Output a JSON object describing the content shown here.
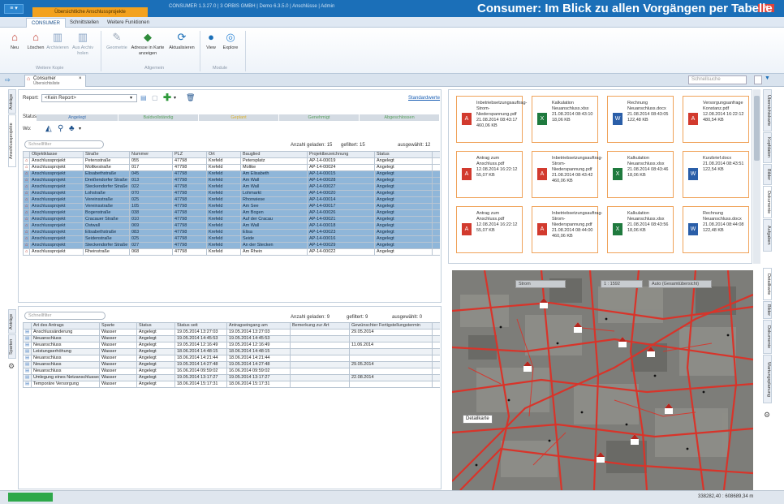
{
  "app": {
    "menu_label": "≡ ▾",
    "context_tab": "Übersichtliche Anschlussprojekte",
    "window_title": "CONSUMER 1.3.27.0 | 3 ORBIS GMBH | Demo 6.3.5.0 | Anschlüsse | Admin",
    "banner": "Consumer: Im Blick zu allen Vorgängen per Tabelle und Karte"
  },
  "ribbon": {
    "tabs": [
      "CONSUMER",
      "Schnittstellen",
      "Weitere Funktionen"
    ],
    "buttons": [
      {
        "label": "Neu",
        "icon": "new-record-icon"
      },
      {
        "label": "Löschen",
        "icon": "delete-record-icon"
      },
      {
        "label": "Archivieren",
        "icon": "archive-icon"
      },
      {
        "label": "Aus Archiv holen",
        "icon": "unarchive-icon"
      },
      {
        "label": "Geometrie",
        "icon": "geometry-icon"
      },
      {
        "label": "Adresse in Karte anzeigen",
        "icon": "map-address-icon"
      },
      {
        "label": "Aktualisieren",
        "icon": "refresh-icon"
      },
      {
        "label": "View",
        "icon": "globe-view-icon"
      },
      {
        "label": "Explore",
        "icon": "globe-explore-icon"
      }
    ],
    "groups": [
      "Weitere Kopie",
      "Allgemein",
      "Module"
    ]
  },
  "doc_tab": {
    "title": "Consumer",
    "subtitle": "Übersichtsliste",
    "close": "×"
  },
  "quick_search_placeholder": "Schnellsuche",
  "left_vtabs": [
    "Anträge",
    "Anschlussprojekte"
  ],
  "left_bottom_vtabs": [
    "Anträge",
    "Sparten"
  ],
  "right_top_vtabs": [
    "Übersichtskarte",
    "Kopfdaten",
    "Bilder",
    "Dokumente",
    "Aufgaben"
  ],
  "right_bottom_vtabs": [
    "Detailkarte",
    "Bilder",
    "Dokumente",
    "Wartungsplanung"
  ],
  "report": {
    "label": "Report:",
    "value": "<Kein Report>",
    "standard_link": "Standardwerte",
    "status_label": "Status:",
    "statuses": [
      "Angelegt",
      "Baldvollständig",
      "Geplant",
      "Genehmigt",
      "Abgeschlossen"
    ],
    "wo_label": "Wo:"
  },
  "upper_grid": {
    "filter_placeholder": "Schnellfilter",
    "loaded": "Anzahl geladen: 15",
    "filtered": "gefiltert: 15",
    "selected": "ausgewählt: 12",
    "columns": [
      "Objektklasse",
      "Straße",
      "Nummer",
      "PLZ",
      "Ort",
      "Bauglied",
      "Projektbezeichnung",
      "Status"
    ],
    "rows": [
      {
        "sel": false,
        "cells": [
          "Anschlussprojekt",
          "Petersstraße",
          "055",
          "47798",
          "Krefeld",
          "Petersplatz",
          "AP-14-00019",
          "Angelegt"
        ]
      },
      {
        "sel": false,
        "cells": [
          "Anschlussprojekt",
          "Moltkestraße",
          "017",
          "47798",
          "Krefeld",
          "Moltke",
          "AP-14-00024",
          "Angelegt"
        ]
      },
      {
        "sel": true,
        "cells": [
          "Anschlussprojekt",
          "Elisabethstraße",
          "045",
          "47798",
          "Krefeld",
          "Am Elisabeth",
          "AP-14-00015",
          "Angelegt"
        ]
      },
      {
        "sel": true,
        "cells": [
          "Anschlussprojekt",
          "Dreißendorfer Straße",
          "013",
          "47798",
          "Krefeld",
          "Am Wall",
          "AP-14-00028",
          "Angelegt"
        ]
      },
      {
        "sel": true,
        "cells": [
          "Anschlussprojekt",
          "Steckendorfer Straße",
          "022",
          "47798",
          "Krefeld",
          "Am Wall",
          "AP-14-00027",
          "Angelegt"
        ]
      },
      {
        "sel": true,
        "cells": [
          "Anschlussprojekt",
          "Lohstraße",
          "070",
          "47798",
          "Krefeld",
          "Lohmarkt",
          "AP-14-00020",
          "Angelegt"
        ]
      },
      {
        "sel": true,
        "cells": [
          "Anschlussprojekt",
          "Vereinsstraße",
          "025",
          "47798",
          "Krefeld",
          "Rhonwiese",
          "AP-14-00014",
          "Angelegt"
        ]
      },
      {
        "sel": true,
        "cells": [
          "Anschlussprojekt",
          "Vereinsstraße",
          "105",
          "47798",
          "Krefeld",
          "Am See",
          "AP-14-00017",
          "Angelegt"
        ]
      },
      {
        "sel": true,
        "cells": [
          "Anschlussprojekt",
          "Bogenstraße",
          "038",
          "47798",
          "Krefeld",
          "Am Bogen",
          "AP-14-00026",
          "Angelegt"
        ]
      },
      {
        "sel": true,
        "cells": [
          "Anschlussprojekt",
          "Cracauer Straße",
          "010",
          "47798",
          "Krefeld",
          "Auf der Cracau",
          "AP-14-00021",
          "Angelegt"
        ]
      },
      {
        "sel": true,
        "cells": [
          "Anschlussprojekt",
          "Ostwall",
          "069",
          "47798",
          "Krefeld",
          "Am Wall",
          "AP-14-00018",
          "Angelegt"
        ]
      },
      {
        "sel": true,
        "cells": [
          "Anschlussprojekt",
          "Elisabethstraße",
          "083",
          "47798",
          "Krefeld",
          "Elisa",
          "AP-14-00023",
          "Angelegt"
        ]
      },
      {
        "sel": true,
        "cells": [
          "Anschlussprojekt",
          "Seidenstraße",
          "025",
          "47798",
          "Krefeld",
          "Seide",
          "AP-14-00016",
          "Angelegt"
        ]
      },
      {
        "sel": true,
        "cells": [
          "Anschlussprojekt",
          "Steckendorfer Straße",
          "027",
          "47798",
          "Krefeld",
          "An der Stecken",
          "AP-14-00029",
          "Angelegt"
        ]
      },
      {
        "sel": false,
        "cells": [
          "Anschlussprojekt",
          "Rheinstraße",
          "068",
          "47798",
          "Krefeld",
          "Am Rhein",
          "AP-14-00022",
          "Angelegt"
        ]
      }
    ]
  },
  "lower_grid": {
    "filter_placeholder": "Schnellfilter",
    "loaded": "Anzahl geladen: 9",
    "filtered": "gefiltert: 9",
    "selected": "ausgewählt: 0",
    "columns": [
      "Art des Antrags",
      "Sparte",
      "Status",
      "Status seit",
      "Antragseingang am",
      "Bemerkung zur Art",
      "Gewünschter Fertigstellungstermin"
    ],
    "rows": [
      [
        "Anschlussänderung",
        "Wasser",
        "Angelegt",
        "19.05.2014 13:27:03",
        "19.05.2014 13:27:03",
        "",
        "29.05.2014"
      ],
      [
        "Neuanschluss",
        "Wasser",
        "Angelegt",
        "19.05.2014 14:45:53",
        "19.05.2014 14:45:53",
        "",
        ""
      ],
      [
        "Neuanschluss",
        "Wasser",
        "Angelegt",
        "19.05.2014 12:16:49",
        "19.05.2014 12:16:49",
        "",
        "11.06.2014"
      ],
      [
        "Leistungserhöhung",
        "Wasser",
        "Angelegt",
        "18.06.2014 14:48:15",
        "18.06.2014 14:48:15",
        "",
        ""
      ],
      [
        "Neuanschluss",
        "Wasser",
        "Angelegt",
        "18.06.2014 14:21:44",
        "18.06.2014 14:21:44",
        "",
        ""
      ],
      [
        "Neuanschluss",
        "Wasser",
        "Angelegt",
        "19.05.2014 14:27:48",
        "19.05.2014 14:27:48",
        "",
        "29.05.2014"
      ],
      [
        "Neuanschluss",
        "Wasser",
        "Angelegt",
        "16.06.2014 09:59:02",
        "16.06.2014 09:59:02",
        "",
        ""
      ],
      [
        "Umlegung eines Netzanschlusses",
        "Wasser",
        "Angelegt",
        "19.05.2014 13:17:27",
        "19.05.2014 13:17:27",
        "",
        "22.08.2014"
      ],
      [
        "Temporäre Versorgung",
        "Wasser",
        "Angelegt",
        "18.06.2014 15:17:31",
        "18.06.2014 15:17:31",
        "",
        ""
      ]
    ]
  },
  "documents": [
    {
      "type": "pdf",
      "name": "Inbetriebsetzungsauftrag-Strom-Niederspannung.pdf",
      "date": "21.08.2014 08:43:17",
      "size": "460,06 KB"
    },
    {
      "type": "xlsx",
      "name": "Kalkulation Neuanschluss.xlsx",
      "date": "21.08.2014 08:43:10",
      "size": "18,06 KB"
    },
    {
      "type": "docx",
      "name": "Rechnung Neuanschluss.docx",
      "date": "21.08.2014 08:43:05",
      "size": "122,48 KB"
    },
    {
      "type": "pdf",
      "name": "Versorgungsanfrage Konstanz.pdf",
      "date": "12.08.2014 16:22:12",
      "size": "480,54 KB"
    },
    {
      "type": "pdf",
      "name": "Antrag zum Anschluss.pdf",
      "date": "12.08.2014 16:22:12",
      "size": "55,07 KB"
    },
    {
      "type": "pdf",
      "name": "Inbetriebsetzungsauftrag-Strom-Niederspannung.pdf",
      "date": "21.08.2014 08:43:42",
      "size": "460,06 KB"
    },
    {
      "type": "xlsx",
      "name": "Kalkulation Neuanschluss.xlsx",
      "date": "21.08.2014 08:43:46",
      "size": "18,06 KB"
    },
    {
      "type": "docx",
      "name": "Kurzbrief.docx",
      "date": "21.08.2014 08:43:51",
      "size": "122,54 KB"
    },
    {
      "type": "pdf",
      "name": "Antrag zum Anschluss.pdf",
      "date": "12.08.2014 16:22:12",
      "size": "55,07 KB"
    },
    {
      "type": "pdf",
      "name": "Inbetriebsetzungsauftrag-Strom-Niederspannung.pdf",
      "date": "21.08.2014 08:44:00",
      "size": "460,06 KB"
    },
    {
      "type": "xlsx",
      "name": "Kalkulation Neuanschluss.xlsx",
      "date": "21.08.2014 08:43:56",
      "size": "18,06 KB"
    },
    {
      "type": "docx",
      "name": "Rechnung Neuanschluss.docx",
      "date": "21.08.2014 08:44:08",
      "size": "122,48 KB"
    }
  ],
  "map": {
    "fields": [
      "Strom",
      "1 : 1592",
      "Auto (Gesamtübersicht)"
    ],
    "label": "Detailkarte"
  },
  "statusbar": {
    "coords": "338282,40 : 608689,34 m"
  },
  "colors": {
    "brand": "#1b6fb8",
    "selection": "#8fb6d9",
    "context_tab": "#f3a21f",
    "doc_border": "#f0a35a",
    "map_lines": "#d8342a"
  }
}
